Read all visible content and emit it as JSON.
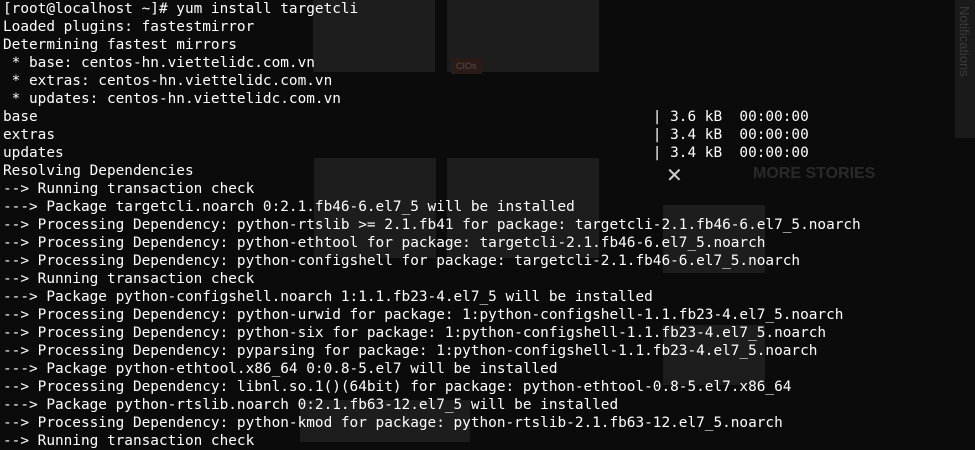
{
  "background_page": {
    "tag": "CIOs",
    "more_stories": "MORE STORIES",
    "notifications": "Notifications",
    "close_symbol": "✕"
  },
  "terminal": {
    "lines": [
      "[root@localhost ~]# yum install targetcli",
      "Loaded plugins: fastestmirror",
      "Determining fastest mirrors",
      " * base: centos-hn.viettelidc.com.vn",
      " * extras: centos-hn.viettelidc.com.vn",
      " * updates: centos-hn.viettelidc.com.vn",
      "base                                                                       | 3.6 kB  00:00:00",
      "extras                                                                     | 3.4 kB  00:00:00",
      "updates                                                                    | 3.4 kB  00:00:00",
      "Resolving Dependencies",
      "--> Running transaction check",
      "---> Package targetcli.noarch 0:2.1.fb46-6.el7_5 will be installed",
      "--> Processing Dependency: python-rtslib >= 2.1.fb41 for package: targetcli-2.1.fb46-6.el7_5.noarch",
      "--> Processing Dependency: python-ethtool for package: targetcli-2.1.fb46-6.el7_5.noarch",
      "--> Processing Dependency: python-configshell for package: targetcli-2.1.fb46-6.el7_5.noarch",
      "--> Running transaction check",
      "---> Package python-configshell.noarch 1:1.1.fb23-4.el7_5 will be installed",
      "--> Processing Dependency: python-urwid for package: 1:python-configshell-1.1.fb23-4.el7_5.noarch",
      "--> Processing Dependency: python-six for package: 1:python-configshell-1.1.fb23-4.el7_5.noarch",
      "--> Processing Dependency: pyparsing for package: 1:python-configshell-1.1.fb23-4.el7_5.noarch",
      "---> Package python-ethtool.x86_64 0:0.8-5.el7 will be installed",
      "--> Processing Dependency: libnl.so.1()(64bit) for package: python-ethtool-0.8-5.el7.x86_64",
      "---> Package python-rtslib.noarch 0:2.1.fb63-12.el7_5 will be installed",
      "--> Processing Dependency: python-kmod for package: python-rtslib-2.1.fb63-12.el7_5.noarch",
      "--> Running transaction check"
    ]
  }
}
